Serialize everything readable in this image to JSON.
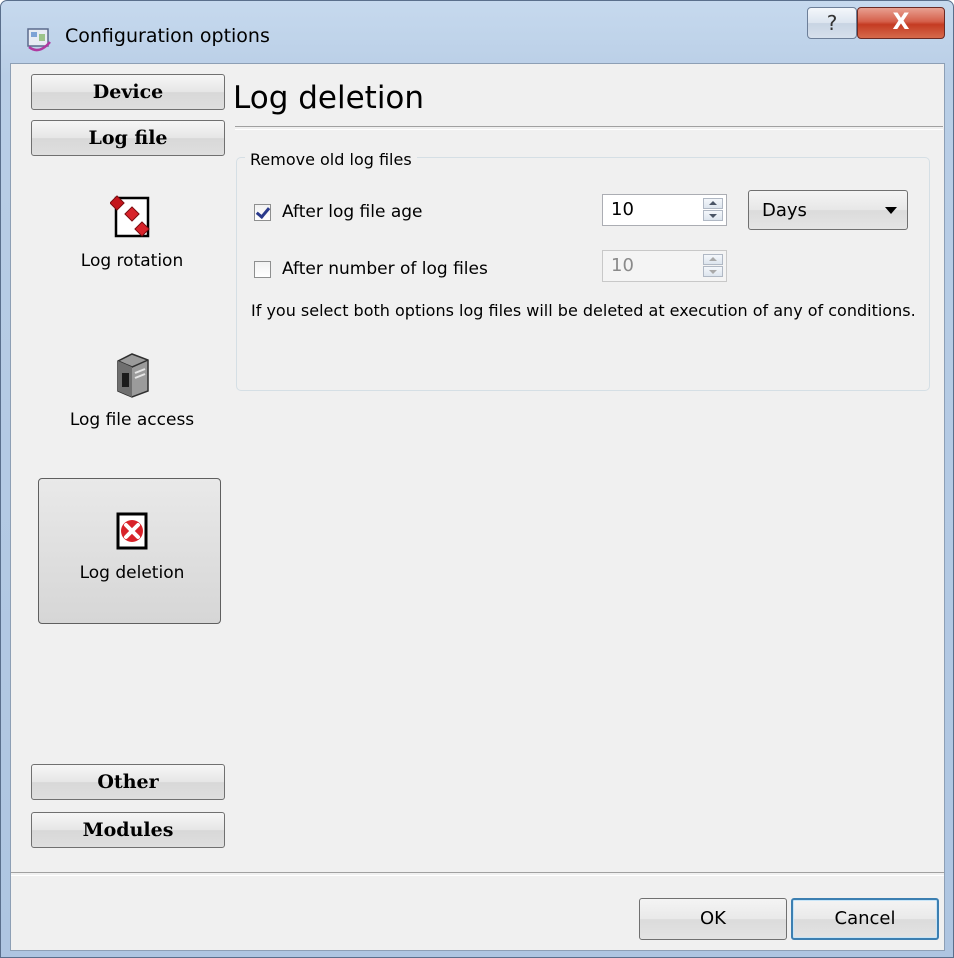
{
  "window": {
    "title": "Configuration options",
    "help_label": "?",
    "close_label": "X"
  },
  "sidebar": {
    "top_buttons": [
      "Device",
      "Log file"
    ],
    "items": [
      {
        "label": "Log rotation",
        "icon": "log-rotation-icon"
      },
      {
        "label": "Log file access",
        "icon": "server-icon"
      },
      {
        "label": "Log deletion",
        "icon": "delete-icon",
        "selected": true
      }
    ],
    "bottom_buttons": [
      "Other",
      "Modules"
    ]
  },
  "page": {
    "title": "Log deletion",
    "group_title": "Remove old log files",
    "age_option": {
      "label": "After log file age",
      "checked": true,
      "value": "10",
      "unit": "Days"
    },
    "count_option": {
      "label": "After number of log files",
      "checked": false,
      "value": "10"
    },
    "info": "If you select both options log files will be deleted at execution of any of conditions."
  },
  "footer": {
    "ok_label": "OK",
    "cancel_label": "Cancel"
  },
  "colors": {
    "frame": "#b9cee6",
    "close_button": "#c43b22",
    "client_bg": "#f0f0f0",
    "default_button_border": "#3c7fb1"
  }
}
